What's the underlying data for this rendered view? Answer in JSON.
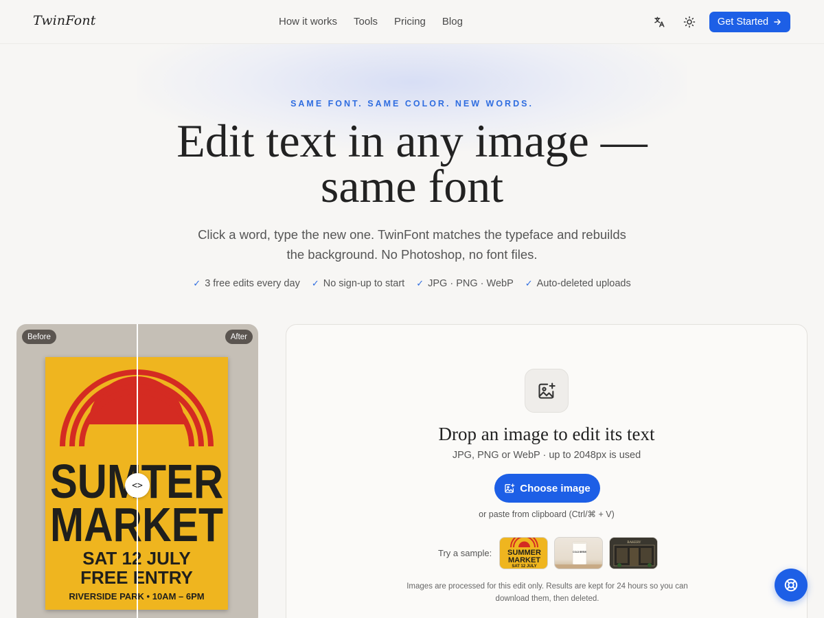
{
  "brand": {
    "logo": "TwinFont"
  },
  "nav": {
    "links": [
      "How it works",
      "Tools",
      "Pricing",
      "Blog"
    ],
    "cta": "Get Started",
    "icons": [
      "translate-icon",
      "sun-icon",
      "arrow-right-icon"
    ]
  },
  "hero": {
    "eyebrow": "SAME FONT. SAME COLOR. NEW WORDS.",
    "title_line1": "Edit text in any image —",
    "title_line2": "same font",
    "subtitle_line1": "Click a word, type the new one. TwinFont matches the typeface and rebuilds",
    "subtitle_line2": "the background. No Photoshop, no font files.",
    "features": [
      "3 free edits every day",
      "No sign-up to start",
      "JPG · PNG · WebP",
      "Auto-deleted uploads"
    ]
  },
  "compare": {
    "before_label": "Before",
    "after_label": "After",
    "handle_glyph": "<>",
    "poster": {
      "line1": "SUMTER",
      "line2": "MARKET",
      "line3": "SAT 12 JULY",
      "line4": "FREE ENTRY",
      "line5": "RIVERSIDE PARK • 10AM – 6PM"
    },
    "colors": {
      "poster": "#efb51f",
      "sun": "#d42b22",
      "ink": "#1f1f1c"
    }
  },
  "upload": {
    "title": "Drop an image to edit its text",
    "subtitle": "JPG, PNG or WebP · up to 2048px is used",
    "button": "Choose image",
    "paste_hint": "or paste from clipboard (Ctrl/⌘ + V)",
    "sample_label": "Try a sample:",
    "samples": [
      {
        "name": "summer-market-poster",
        "line1": "SUMMER",
        "line2": "MARKET",
        "line3": "SAT 12 JULY"
      },
      {
        "name": "coffee-bag",
        "label": "COLD BREW"
      },
      {
        "name": "bakery-storefront",
        "label": "BAKERY"
      }
    ],
    "privacy_line1": "Images are processed for this edit only. Results are kept for 24 hours so you can",
    "privacy_line2": "download them, then deleted."
  },
  "accent": "#1d5fe6"
}
